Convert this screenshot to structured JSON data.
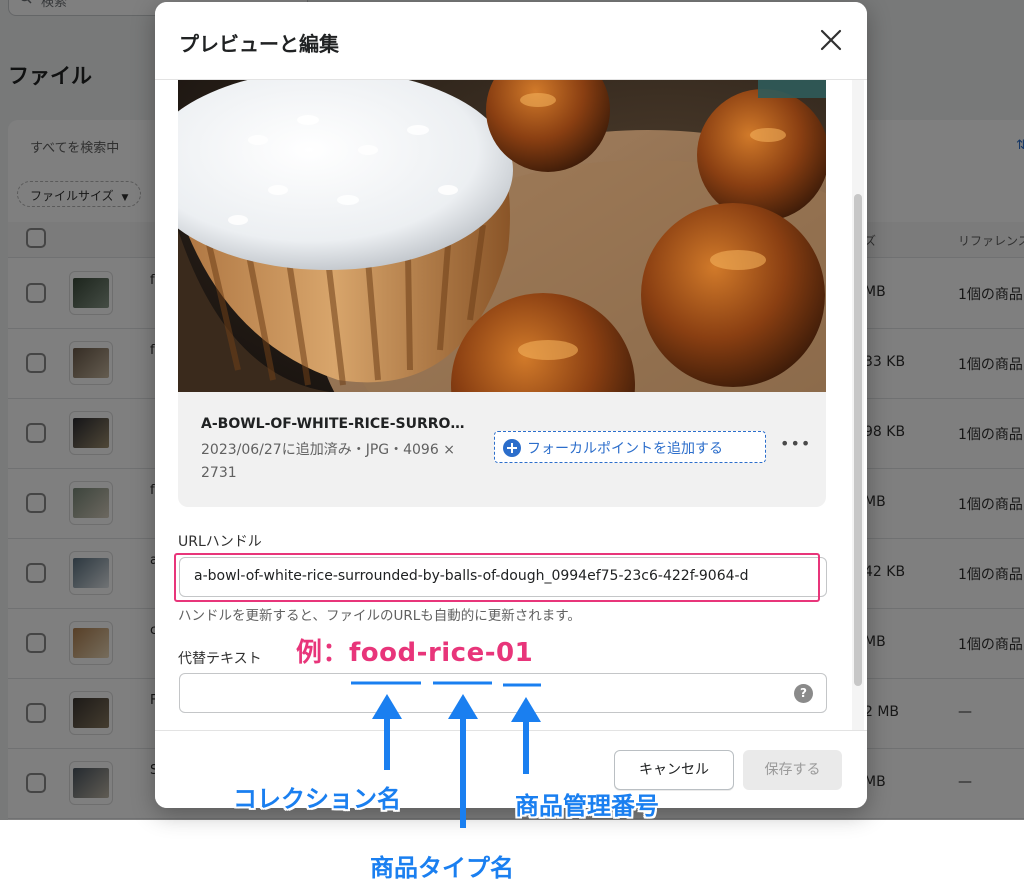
{
  "background": {
    "search_placeholder": "検索",
    "page_title": "ファイル",
    "searching_label": "すべてを検索中",
    "filter_chip": "ファイルサイズ",
    "sort_glyph": "⇅",
    "header_size": "ズ",
    "header_references": "リファレンス",
    "name_initials": [
      "f",
      "f",
      "",
      "f",
      "a",
      "c",
      "F",
      "S"
    ],
    "row_sizes": [
      "MB",
      "33 KB",
      "98 KB",
      "MB",
      "42 KB",
      "MB",
      "2 MB",
      "MB"
    ],
    "row_refs": [
      "1個の商品",
      "1個の商品",
      "1個の商品",
      "1個の商品",
      "1個の商品",
      "1個の商品",
      "—",
      "—"
    ]
  },
  "modal": {
    "title": "プレビューと編集",
    "file_name": "A-BOWL-OF-WHITE-RICE-SURRO…",
    "file_meta": "2023/06/27に追加済み・JPG・4096 × 2731",
    "focal_point_button": "フォーカルポイントを追加する",
    "more_button": "•••",
    "url_handle_label": "URLハンドル",
    "url_handle_value": "a-bowl-of-white-rice-surrounded-by-balls-of-dough_0994ef75-23c6-422f-9064-d",
    "url_handle_help": "ハンドルを更新すると、ファイルのURLも自動的に更新されます。",
    "alt_text_label": "代替テキスト",
    "alt_text_value": "",
    "help_glyph": "?",
    "cancel_button": "キャンセル",
    "save_button": "保存する"
  },
  "annotations": {
    "example": "例：food-rice-01",
    "collection_name": "コレクション名",
    "product_type_name": "商品タイプ名",
    "product_id": "商品管理番号",
    "highlight_color": "#e8357a",
    "arrow_color": "#1a7ff0"
  }
}
